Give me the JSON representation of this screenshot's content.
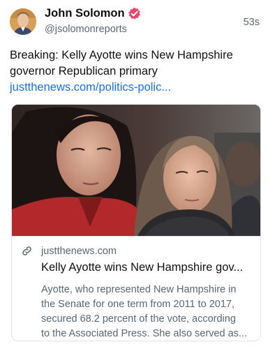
{
  "author": {
    "name": "John Solomon",
    "handle": "@jsolomonreports",
    "time": "53s",
    "badge_color": "#e8476b"
  },
  "post": {
    "text_lines": [
      "Breaking: Kelly Ayotte wins New Hampshire",
      "governor Republican primary"
    ],
    "link_text": "justthenews.com/politics-polic...",
    "link_color": "#1d6ee8"
  },
  "card": {
    "image_icon": "photo-two-women",
    "domain": "justthenews.com",
    "title": "Kelly Ayotte wins New Hampshire gov...",
    "description_lines": [
      "Ayotte, who represented New Hampshire in",
      "the Senate for one term from 2011 to 2017,",
      "secured 68.2 percent of the vote, according",
      "to the Associated Press. She also served as..."
    ]
  }
}
